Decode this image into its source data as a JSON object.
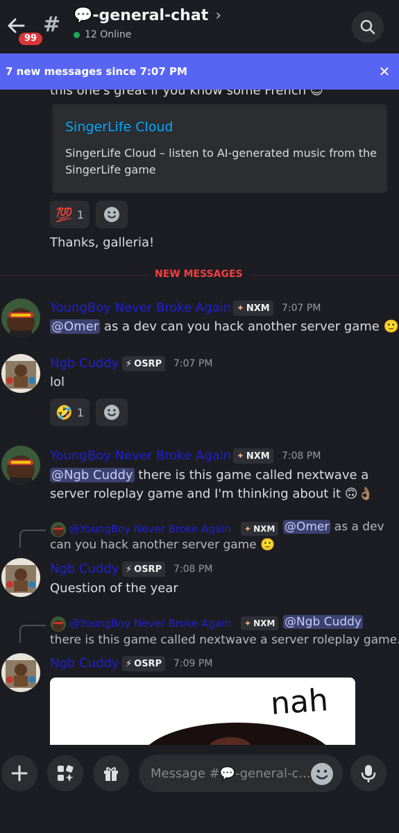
{
  "header": {
    "unread_count": "99",
    "channel_name": "💬-general-chat",
    "online_text": "12 Online"
  },
  "banner": {
    "text": "7 new messages since 7:07 PM"
  },
  "embed": {
    "above_text": "this one's great if you know some French 😊",
    "title": "SingerLife Cloud",
    "description": "SingerLife Cloud – listen to AI-generated music from the SingerLife game"
  },
  "reaction1": {
    "emoji": "💯",
    "count": "1"
  },
  "thanks_text": "Thanks, galleria!",
  "divider_label": "NEW MESSAGES",
  "messages": [
    {
      "author": "YoungBoy Never Broke Again",
      "tag": "NXM",
      "time": "7:07 PM",
      "mention": "@Omer",
      "text": " as a dev can you hack another server game 🙂"
    },
    {
      "author": "Ngb Cuddy",
      "tag": "OSRP",
      "time": "7:07 PM",
      "text": "lol",
      "reaction_emoji": "🤣",
      "reaction_count": "1"
    },
    {
      "author": "YoungBoy Never Broke Again",
      "tag": "NXM",
      "time": "7:08 PM",
      "mention": "@Ngb Cuddy",
      "text_line1": " there is this game called nextwave a",
      "text_line2": "server roleplay game and I'm thinking about it 🙃👌🏽"
    },
    {
      "reply_author": "@YoungBoy Never Broke Again",
      "reply_tag": "NXM",
      "reply_mention": "@Omer",
      "reply_text_1": " as a dev",
      "reply_text_2": "can you hack another server game 🙂",
      "author": "Ngb Cuddy",
      "tag": "OSRP",
      "time": "7:08 PM",
      "text": "Question of the year"
    },
    {
      "reply_author": "@YoungBoy Never Broke Again",
      "reply_tag": "NXM",
      "reply_mention": "@Ngb Cuddy",
      "reply_text_2": "there is this game called nextwave a server roleplay game...",
      "author": "Ngb Cuddy",
      "tag": "OSRP",
      "time": "7:09 PM",
      "image_text": "nah"
    }
  ],
  "composer": {
    "placeholder": "Message #💬-general-c..."
  },
  "colors": {
    "background": "#1c1d22",
    "banner": "#5865f2",
    "username": "#1f1fd8",
    "new_messages": "#f23f43",
    "link": "#00a8fc"
  }
}
